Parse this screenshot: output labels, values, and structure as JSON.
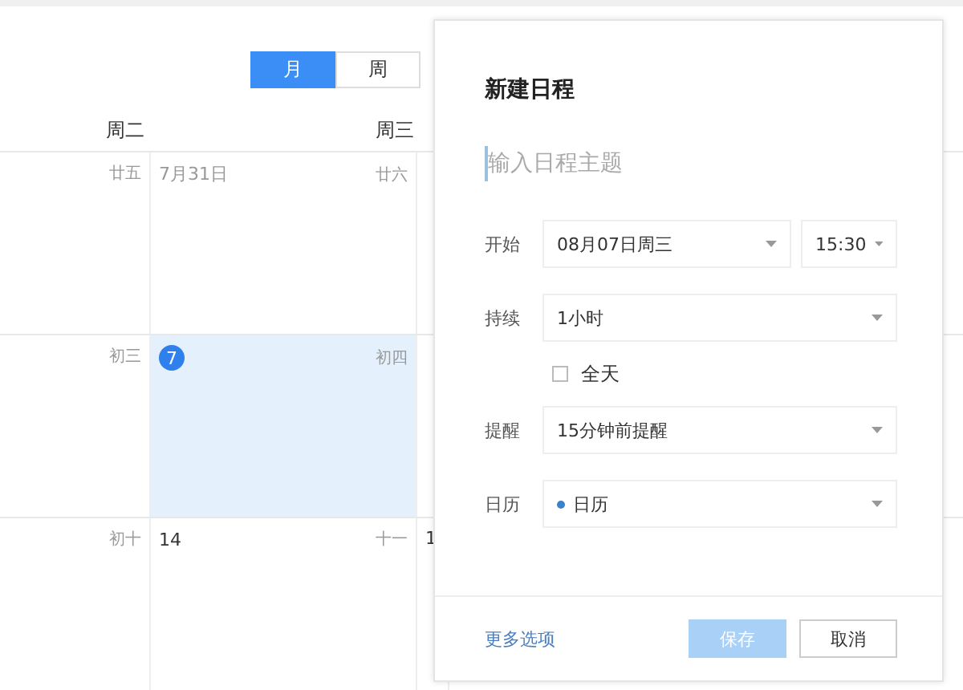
{
  "view_toggle": [
    {
      "label": "月",
      "selected": true
    },
    {
      "label": "周",
      "selected": false
    }
  ],
  "weekdays": [
    "周二",
    "周三"
  ],
  "weeks": [
    {
      "days": [
        {
          "lunar": "廿五",
          "selected": false
        },
        {
          "date": "7月31日",
          "lunar": "廿六",
          "selected": false,
          "today": false
        }
      ]
    },
    {
      "days": [
        {
          "lunar": "初三",
          "selected": false
        },
        {
          "date": "7",
          "lunar": "初四",
          "selected": true,
          "today": true
        }
      ]
    },
    {
      "days": [
        {
          "lunar": "初十",
          "selected": false
        },
        {
          "date": "14",
          "lunar": "十一",
          "selected": false,
          "today": false
        },
        {
          "date": "1",
          "selected": false,
          "today": false
        }
      ]
    }
  ],
  "dialog": {
    "title": "新建日程",
    "subject_placeholder": "输入日程主题",
    "fields": [
      {
        "kind": "datetime",
        "label": "开始",
        "value": "08月07日周三",
        "time": "15:30"
      },
      {
        "kind": "select",
        "label": "持续",
        "value": "1小时"
      },
      {
        "kind": "checkbox",
        "label": "全天",
        "checked": false
      },
      {
        "kind": "select",
        "label": "提醒",
        "value": "15分钟前提醒"
      },
      {
        "kind": "calendar",
        "label": "日历",
        "value": "日历"
      }
    ],
    "more_link": "更多选项",
    "buttons": [
      {
        "label": "保存",
        "disabled": true
      },
      {
        "label": "取消",
        "disabled": false
      }
    ]
  }
}
